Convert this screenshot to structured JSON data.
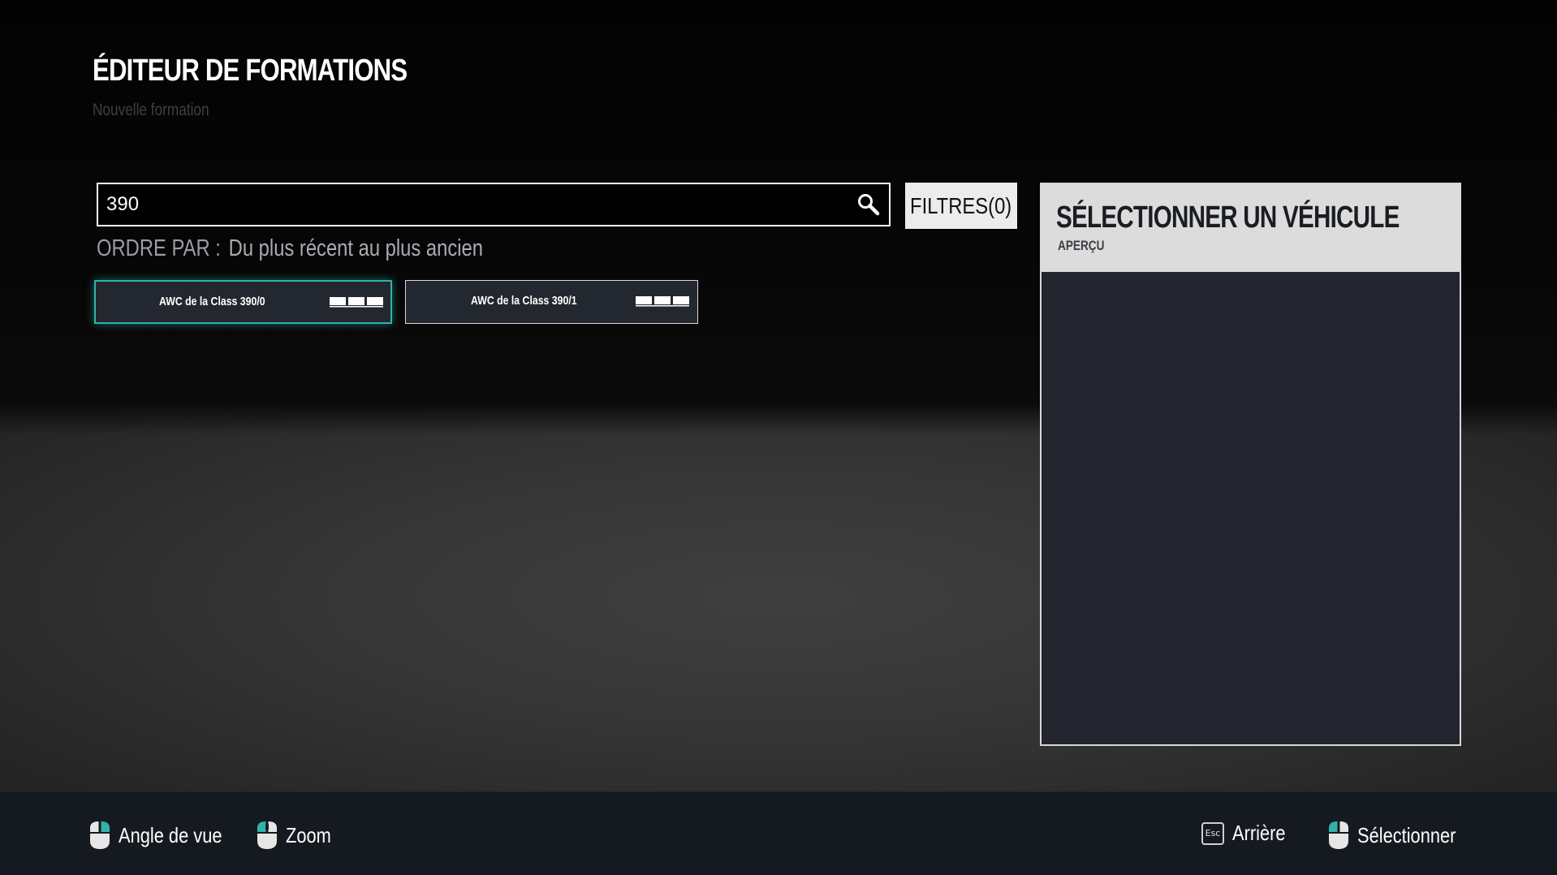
{
  "header": {
    "title": "ÉDITEUR DE FORMATIONS",
    "subtitle": "Nouvelle formation"
  },
  "search": {
    "value": "390",
    "icon": "search-icon"
  },
  "filters": {
    "label": "FILTRES(0)"
  },
  "sort": {
    "label": "ORDRE PAR :",
    "value": "Du plus récent au plus ancien"
  },
  "vehicles": [
    {
      "label": "AWC de la Class 390/0",
      "icon": "train-icon",
      "selected": true
    },
    {
      "label": "AWC de la Class 390/1",
      "icon": "train-icon",
      "selected": false
    }
  ],
  "preview": {
    "title": "SÉLECTIONNER UN VÉHICULE",
    "subtitle": "APERÇU"
  },
  "footer": {
    "hints": [
      {
        "icon": "mouse-right-icon",
        "label": "Angle de vue"
      },
      {
        "icon": "mouse-scroll-icon",
        "label": "Zoom"
      },
      {
        "icon": "esc-key-icon",
        "key": "Esc",
        "label": "Arrière"
      },
      {
        "icon": "mouse-left-icon",
        "label": "Sélectionner"
      }
    ]
  },
  "colors": {
    "accent": "#2fb3a8",
    "panel": "#23262f",
    "footer": "#151a20"
  }
}
